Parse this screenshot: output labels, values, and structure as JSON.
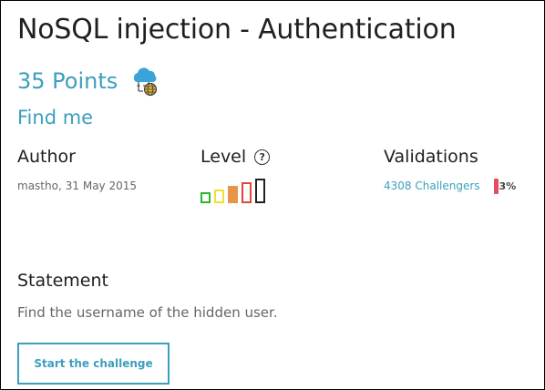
{
  "challenge": {
    "title": "NoSQL injection - Authentication",
    "points": "35 Points",
    "category_icon": "cloud-network-globe-icon",
    "subtitle": "Find me"
  },
  "meta": {
    "author_label": "Author",
    "author_name": "mastho,",
    "author_date": "31 May 2015",
    "level_label": "Level",
    "level_help_symbol": "?",
    "level": 4,
    "level_max": 5,
    "level_colors": [
      "#2bb52b",
      "#f0e030",
      "#e8954a",
      "#e0473a",
      "#222222"
    ],
    "validations_label": "Validations",
    "challengers_link": "4308 Challengers",
    "validation_rate_text": "3%",
    "validation_rate_color": "#e84a5f"
  },
  "statement": {
    "heading": "Statement",
    "text": "Find the username of the hidden user."
  },
  "actions": {
    "start_label": "Start the challenge",
    "accent_color": "#3c9fbd"
  }
}
